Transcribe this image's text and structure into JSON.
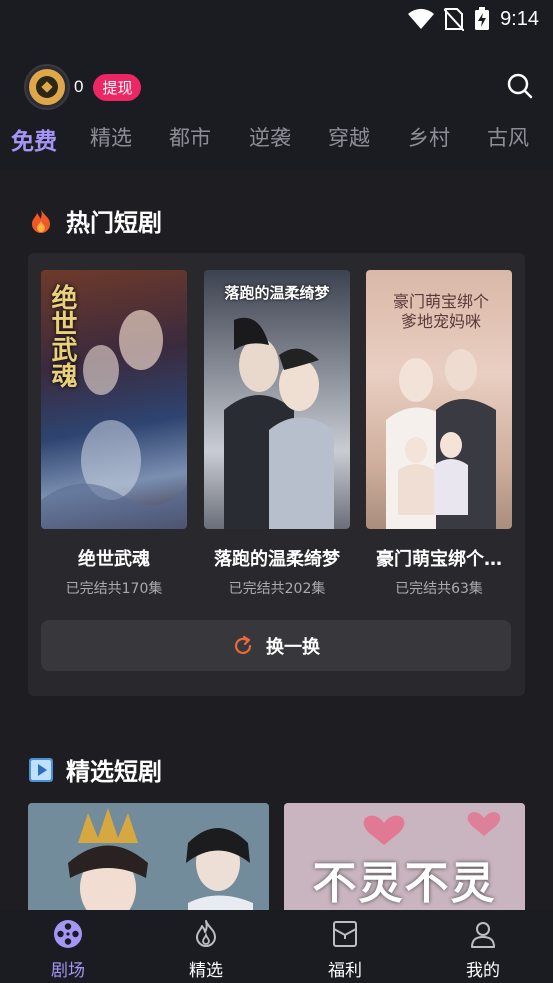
{
  "status": {
    "time": "9:14"
  },
  "header": {
    "coin_count": "0",
    "withdraw_label": "提现"
  },
  "tabs": [
    "免费",
    "精选",
    "都市",
    "逆袭",
    "穿越",
    "乡村",
    "古风"
  ],
  "hot": {
    "title": "热门短剧",
    "dramas": [
      {
        "title": "绝世武魂",
        "meta": "已完结共170集",
        "poster_text": "绝世武魂"
      },
      {
        "title": "落跑的温柔绮梦",
        "meta": "已完结共202集",
        "poster_text": "落跑的温柔绮梦"
      },
      {
        "title": "豪门萌宝绑个…",
        "meta": "已完结共63集",
        "poster_text": "豪门萌宝绑个爹地宠妈咪"
      }
    ],
    "refresh_label": "换一换"
  },
  "featured": {
    "title": "精选短剧",
    "poster2_text": "不灵不灵"
  },
  "nav": [
    "剧场",
    "精选",
    "福利",
    "我的"
  ],
  "colors": {
    "accent": "#a595f5",
    "badge": "#ec2763",
    "refresh_icon": "#e8693a"
  }
}
